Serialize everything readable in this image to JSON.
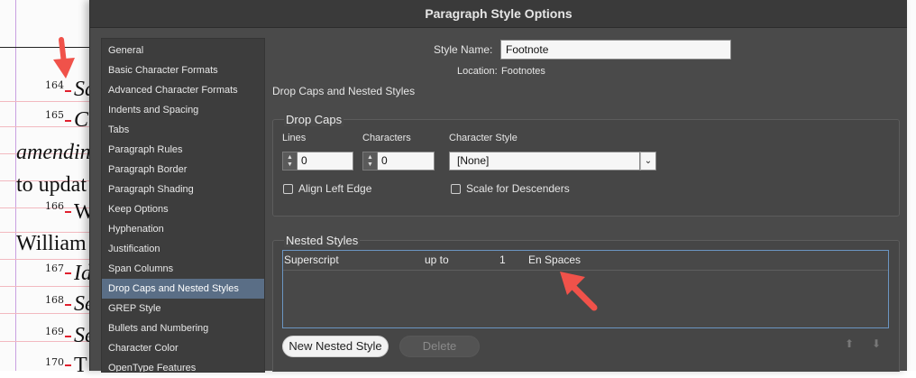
{
  "document": {
    "footnotes": [
      {
        "number": "164",
        "snippet": "Sa"
      },
      {
        "number": "165",
        "snippet": "C"
      },
      {
        "number": "166",
        "snippet": "W"
      },
      {
        "number": "167",
        "snippet": "Id"
      },
      {
        "number": "168",
        "snippet": "Se"
      },
      {
        "number": "169",
        "snippet": "Se"
      },
      {
        "number": "170",
        "snippet": "T"
      }
    ],
    "lines": [
      "amendin",
      "to updat",
      "William"
    ]
  },
  "dialog": {
    "title": "Paragraph Style Options",
    "style_name_label": "Style Name:",
    "style_name_value": "Footnote",
    "location_label": "Location:",
    "location_value": "Footnotes",
    "section_heading": "Drop Caps and Nested Styles"
  },
  "sidebar": {
    "items": [
      {
        "label": "General"
      },
      {
        "label": "Basic Character Formats"
      },
      {
        "label": "Advanced Character Formats"
      },
      {
        "label": "Indents and Spacing"
      },
      {
        "label": "Tabs"
      },
      {
        "label": "Paragraph Rules"
      },
      {
        "label": "Paragraph Border"
      },
      {
        "label": "Paragraph Shading"
      },
      {
        "label": "Keep Options"
      },
      {
        "label": "Hyphenation"
      },
      {
        "label": "Justification"
      },
      {
        "label": "Span Columns"
      },
      {
        "label": "Drop Caps and Nested Styles",
        "selected": true
      },
      {
        "label": "GREP Style"
      },
      {
        "label": "Bullets and Numbering"
      },
      {
        "label": "Character Color"
      },
      {
        "label": "OpenType Features"
      }
    ]
  },
  "drop_caps": {
    "title": "Drop Caps",
    "lines_label": "Lines",
    "lines_value": "0",
    "characters_label": "Characters",
    "characters_value": "0",
    "character_style_label": "Character Style",
    "character_style_value": "[None]",
    "align_left_edge_label": "Align Left Edge",
    "align_left_edge_checked": false,
    "scale_for_descenders_label": "Scale for Descenders",
    "scale_for_descenders_checked": false
  },
  "nested_styles": {
    "title": "Nested Styles",
    "rows": [
      {
        "style": "Superscript",
        "mode": "up to",
        "count": "1",
        "delimiter": "En Spaces"
      }
    ],
    "new_button": "New Nested Style",
    "delete_button": "Delete"
  },
  "colors": {
    "accent": "#5a6e86",
    "callout": "#f0524a",
    "footnote_mark": "#e0202e"
  },
  "icons": {
    "stepper": "up-down-arrows-icon",
    "dropdown": "chevron-down-icon",
    "move_up": "arrow-up-icon",
    "move_down": "arrow-down-icon",
    "callout": "callout-arrow-icon"
  }
}
